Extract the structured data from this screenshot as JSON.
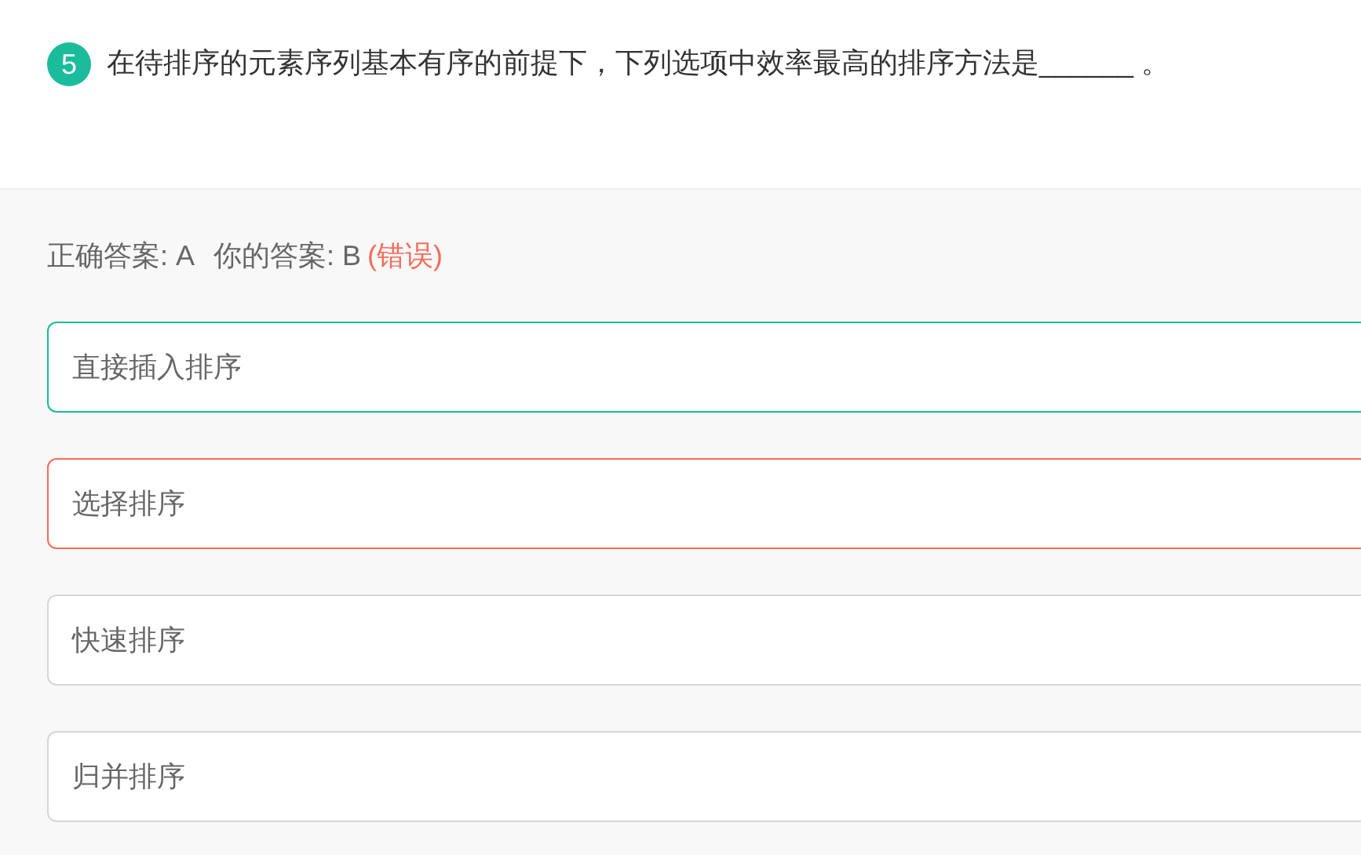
{
  "question": {
    "number": "5",
    "text": "在待排序的元素序列基本有序的前提下，下列选项中效率最高的排序方法是______ 。"
  },
  "answer": {
    "correct": "正确答案: A",
    "yours": "你的答案: B",
    "verdict": "(错误)"
  },
  "options": [
    {
      "text": "直接插入排序",
      "kind": "correct"
    },
    {
      "text": "选择排序",
      "kind": "wrong"
    },
    {
      "text": "快速排序",
      "kind": "plain"
    },
    {
      "text": "归并排序",
      "kind": "plain"
    }
  ]
}
